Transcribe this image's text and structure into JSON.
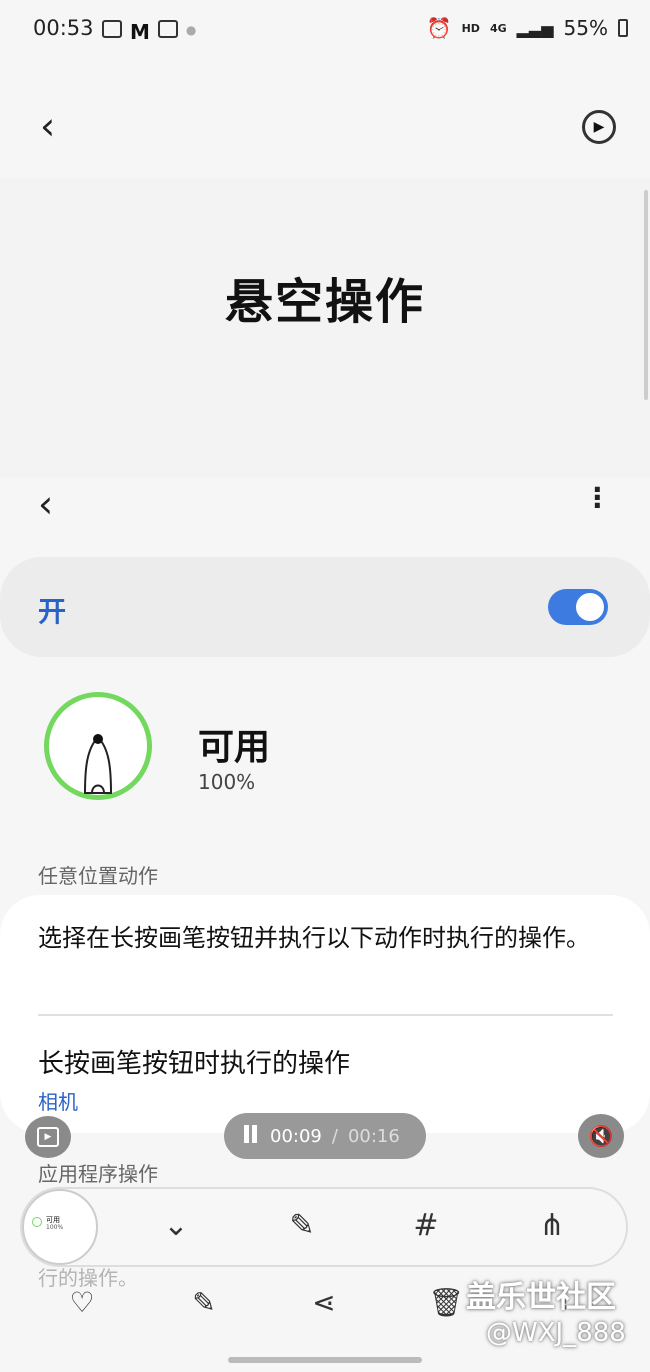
{
  "status": {
    "time": "00:53",
    "network": "4G",
    "hd": "HD",
    "battery": "55%"
  },
  "page": {
    "title": "悬空操作"
  },
  "toggle": {
    "label": "开",
    "state": true
  },
  "pen": {
    "status": "可用",
    "battery": "100%"
  },
  "section1": {
    "label": "任意位置动作"
  },
  "card": {
    "description": "选择在长按画笔按钮并执行以下动作时执行的操作。",
    "item_title": "长按画笔按钮时执行的操作",
    "item_value": "相机"
  },
  "section2": {
    "label": "应用程序操作"
  },
  "recorder": {
    "elapsed": "00:09",
    "separator": "/",
    "total": "00:16"
  },
  "ghost_text": "行的操作。",
  "watermark": {
    "line1": "盖乐世社区",
    "line2": "@WXJ_888"
  },
  "thumb_text": {
    "title": "可用",
    "pct": "100%"
  },
  "colors": {
    "accent": "#3d7be0",
    "ring": "#72d85e"
  }
}
